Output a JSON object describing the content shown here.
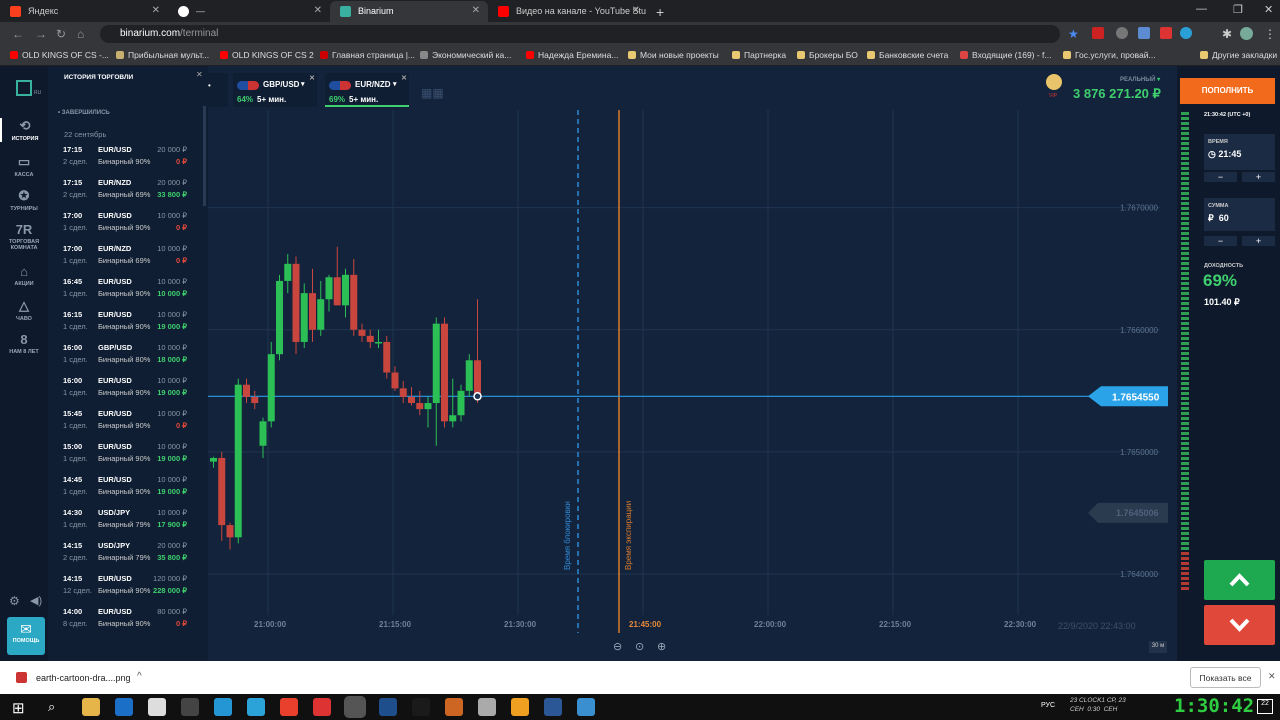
{
  "browser": {
    "tabs": [
      {
        "label": "Яндекс",
        "color": "#fc3f1d"
      },
      {
        "label": "—",
        "color": "#ffffff"
      },
      {
        "label": "Binarium",
        "color": "#3ab0a0"
      },
      {
        "label": "Видео на канале - YouTube Stu",
        "color": "#ff0000"
      }
    ],
    "url_host": "binarium.com",
    "url_path": "/terminal",
    "bookmarks": [
      {
        "label": "OLD KINGS OF CS -...",
        "color": "#ff0000"
      },
      {
        "label": "Прибыльная мульт...",
        "color": "#c8b070"
      },
      {
        "label": "OLD KINGS OF CS 2",
        "color": "#ff0000"
      },
      {
        "label": "Главная страница |...",
        "color": "#c00"
      },
      {
        "label": "Экономический ка...",
        "color": "#888"
      },
      {
        "label": "Надежда Еремина...",
        "color": "#ff0000"
      },
      {
        "label": "Мои новые проекты",
        "color": "#e8c870"
      },
      {
        "label": "Партнерка",
        "color": "#e8c870"
      },
      {
        "label": "Брокеры БО",
        "color": "#e8c870"
      },
      {
        "label": "Банковские счета",
        "color": "#e8c870"
      },
      {
        "label": "Входящие (169) - f...",
        "color": "#d44"
      },
      {
        "label": "Гос.услуги, провай...",
        "color": "#e8c870"
      },
      {
        "label": "Другие закладки",
        "color": "#e8c870"
      }
    ]
  },
  "sidebar": {
    "logo_suffix": "RU",
    "items": [
      {
        "label": "ИСТОРИЯ",
        "icon": "history-icon",
        "glyph": "⟲"
      },
      {
        "label": "КАССА",
        "icon": "wallet-icon",
        "glyph": "▭"
      },
      {
        "label": "ТУРНИРЫ",
        "icon": "tournament-icon",
        "glyph": "✪"
      },
      {
        "label": "ТОРГОВАЯ КОМНАТА",
        "icon": "trading-room-icon",
        "glyph": "7R"
      },
      {
        "label": "АКЦИИ",
        "icon": "gift-icon",
        "glyph": "⌂"
      },
      {
        "label": "ЧАВО",
        "icon": "faq-icon",
        "glyph": "△"
      },
      {
        "label": "НАМ 8 ЛЕТ",
        "icon": "anniversary-icon",
        "glyph": "8"
      }
    ],
    "help_label": "ПОМОЩЬ"
  },
  "history": {
    "title": "ИСТОРИЯ ТОРГОВЛИ",
    "section": "ЗАВЕРШИЛИСЬ",
    "date": "22 сентябрь",
    "rows": [
      {
        "time": "17:15",
        "pair": "EUR/USD",
        "amount": "20 000 ₽",
        "count": "2 сдел.",
        "kind": "Бинарный 90%",
        "result": "0 ₽",
        "win": false
      },
      {
        "time": "17:15",
        "pair": "EUR/NZD",
        "amount": "20 000 ₽",
        "count": "2 сдел.",
        "kind": "Бинарный 69%",
        "result": "33 800 ₽",
        "win": true
      },
      {
        "time": "17:00",
        "pair": "EUR/USD",
        "amount": "10 000 ₽",
        "count": "1 сдел.",
        "kind": "Бинарный 90%",
        "result": "0 ₽",
        "win": false
      },
      {
        "time": "17:00",
        "pair": "EUR/NZD",
        "amount": "10 000 ₽",
        "count": "1 сдел.",
        "kind": "Бинарный 69%",
        "result": "0 ₽",
        "win": false
      },
      {
        "time": "16:45",
        "pair": "EUR/USD",
        "amount": "10 000 ₽",
        "count": "1 сдел.",
        "kind": "Бинарный 90%",
        "result": "10 000 ₽",
        "win": true
      },
      {
        "time": "16:15",
        "pair": "EUR/USD",
        "amount": "10 000 ₽",
        "count": "1 сдел.",
        "kind": "Бинарный 90%",
        "result": "19 000 ₽",
        "win": true
      },
      {
        "time": "16:00",
        "pair": "GBP/USD",
        "amount": "10 000 ₽",
        "count": "1 сдел.",
        "kind": "Бинарный 80%",
        "result": "18 000 ₽",
        "win": true
      },
      {
        "time": "16:00",
        "pair": "EUR/USD",
        "amount": "10 000 ₽",
        "count": "1 сдел.",
        "kind": "Бинарный 90%",
        "result": "19 000 ₽",
        "win": true
      },
      {
        "time": "15:45",
        "pair": "EUR/USD",
        "amount": "10 000 ₽",
        "count": "1 сдел.",
        "kind": "Бинарный 90%",
        "result": "0 ₽",
        "win": false
      },
      {
        "time": "15:00",
        "pair": "EUR/USD",
        "amount": "10 000 ₽",
        "count": "1 сдел.",
        "kind": "Бинарный 90%",
        "result": "19 000 ₽",
        "win": true
      },
      {
        "time": "14:45",
        "pair": "EUR/USD",
        "amount": "10 000 ₽",
        "count": "1 сдел.",
        "kind": "Бинарный 90%",
        "result": "19 000 ₽",
        "win": true
      },
      {
        "time": "14:30",
        "pair": "USD/JPY",
        "amount": "10 000 ₽",
        "count": "1 сдел.",
        "kind": "Бинарный 79%",
        "result": "17 900 ₽",
        "win": true
      },
      {
        "time": "14:15",
        "pair": "USD/JPY",
        "amount": "20 000 ₽",
        "count": "2 сдел.",
        "kind": "Бинарный 79%",
        "result": "35 800 ₽",
        "win": true
      },
      {
        "time": "14:15",
        "pair": "EUR/USD",
        "amount": "120 000 ₽",
        "count": "12 сдел.",
        "kind": "Бинарный 90%",
        "result": "228 000 ₽",
        "win": true
      },
      {
        "time": "14:00",
        "pair": "EUR/USD",
        "amount": "80 000 ₽",
        "count": "8 сдел.",
        "kind": "Бинарный 90%",
        "result": "0 ₽",
        "win": false
      }
    ]
  },
  "assets": [
    {
      "pair": "GBP/USD",
      "percent": "64%",
      "duration": "5+ мин.",
      "active": false
    },
    {
      "pair": "EUR/NZD",
      "percent": "69%",
      "duration": "5+ мин.",
      "active": true
    }
  ],
  "account": {
    "type": "РЕАЛЬНЫЙ",
    "balance": "3 876 271.20 ₽",
    "vip": "VIP",
    "deposit_label": "ПОПОЛНИТЬ",
    "clock": "21:30:42 (UTC +0)"
  },
  "trade": {
    "time_label": "ВРЕМЯ",
    "time_value": "21:45",
    "sum_label": "СУММА",
    "currency": "₽",
    "sum_value": "60",
    "profit_label": "ДОХОДНОСТЬ",
    "profit_percent": "69%",
    "profit_amount": "101.40 ₽",
    "minus": "−",
    "plus": "+"
  },
  "chart_data": {
    "type": "candlestick",
    "price_labels": [
      "1.7670000",
      "1.7660000",
      "1.7650000",
      "1.7640000"
    ],
    "price_values": [
      1.767,
      1.766,
      1.765,
      1.764
    ],
    "current_price": "1.7654550",
    "current_value": 1.765455,
    "strike_label": "1.7645006",
    "strike_value": 1.7645006,
    "time_labels": [
      "21:00:00",
      "21:15:00",
      "21:30:00",
      "21:45:00",
      "22:00:00",
      "22:15:00",
      "22:30:00"
    ],
    "block_label": "Время блокировки",
    "expiry_label": "Время экспирации",
    "date_label": "22/9/2020 22:43:00",
    "interval": "30 м",
    "ylim": [
      1.7635,
      1.7678
    ],
    "candles": [
      [
        1.76492,
        1.76496,
        1.76487,
        1.76495
      ],
      [
        1.76495,
        1.765,
        1.76427,
        1.7644
      ],
      [
        1.7644,
        1.76442,
        1.7642,
        1.7643
      ],
      [
        1.7643,
        1.7656,
        1.76425,
        1.76555
      ],
      [
        1.76555,
        1.7656,
        1.7654,
        1.76545
      ],
      [
        1.76545,
        1.7655,
        1.76535,
        1.7654
      ],
      [
        1.76505,
        1.76528,
        1.76495,
        1.76525
      ],
      [
        1.76525,
        1.7659,
        1.7652,
        1.7658
      ],
      [
        1.7658,
        1.76645,
        1.76575,
        1.7664
      ],
      [
        1.7664,
        1.76662,
        1.7663,
        1.76654
      ],
      [
        1.76654,
        1.7666,
        1.7658,
        1.7659
      ],
      [
        1.7659,
        1.76638,
        1.76585,
        1.7663
      ],
      [
        1.7663,
        1.7665,
        1.7659,
        1.766
      ],
      [
        1.766,
        1.7664,
        1.76595,
        1.76625
      ],
      [
        1.76625,
        1.76645,
        1.76615,
        1.76643
      ],
      [
        1.76643,
        1.76668,
        1.7662,
        1.7662
      ],
      [
        1.7662,
        1.7665,
        1.7661,
        1.76645
      ],
      [
        1.76645,
        1.76658,
        1.76595,
        1.766
      ],
      [
        1.766,
        1.76605,
        1.7659,
        1.76595
      ],
      [
        1.76595,
        1.766,
        1.76585,
        1.7659
      ],
      [
        1.7659,
        1.766,
        1.76585,
        1.7659
      ],
      [
        1.7659,
        1.76595,
        1.7656,
        1.76565
      ],
      [
        1.76565,
        1.7657,
        1.7655,
        1.76552
      ],
      [
        1.76552,
        1.76558,
        1.7654,
        1.76545
      ],
      [
        1.76545,
        1.76553,
        1.76538,
        1.7654
      ],
      [
        1.7654,
        1.7655,
        1.7653,
        1.76535
      ],
      [
        1.76535,
        1.76545,
        1.7652,
        1.7654
      ],
      [
        1.7654,
        1.7661,
        1.76505,
        1.76605
      ],
      [
        1.76605,
        1.7661,
        1.7652,
        1.76525
      ],
      [
        1.76525,
        1.7656,
        1.7652,
        1.7653
      ],
      [
        1.7653,
        1.76555,
        1.76525,
        1.7655
      ],
      [
        1.7655,
        1.7658,
        1.76545,
        1.76575
      ],
      [
        1.76575,
        1.76625,
        1.7654,
        1.765455
      ]
    ]
  },
  "downloads": {
    "file": "earth-cartoon-dra....png",
    "show_all": "Показать все"
  },
  "taskbar": {
    "lang": "РУС",
    "clock_widget": "23 CLOCK1 СР, 23",
    "clock_widget2": "СЕН  0:30  СЕН",
    "time": "1:30:42",
    "notif": "22"
  }
}
